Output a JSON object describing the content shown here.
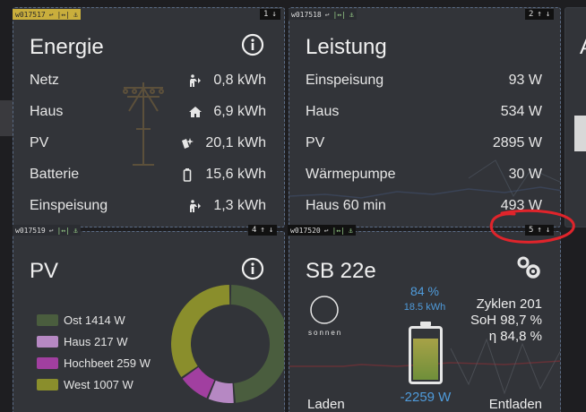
{
  "colors": {
    "card_bg": "#34363c",
    "accent_blue": "#4f9bdb",
    "border_dashed": "#5b6c86",
    "annotation_red": "#e0242b",
    "pv_ost": "#4a5d3e",
    "pv_haus": "#b688c3",
    "pv_hochbeet": "#a13fa0",
    "pv_west": "#8a8e2c"
  },
  "widgets": {
    "energie": {
      "id": "w017517",
      "order": "1"
    },
    "leistung": {
      "id": "w017518",
      "order": "2"
    },
    "pv": {
      "id": "w017519",
      "order": "4"
    },
    "sb": {
      "id": "w017520",
      "order": "5"
    }
  },
  "energie": {
    "title": "Energie",
    "rows": [
      {
        "label": "Netz",
        "icon": "pylon-person-icon",
        "value": "0,8 kWh"
      },
      {
        "label": "Haus",
        "icon": "house-icon",
        "value": "6,9 kWh"
      },
      {
        "label": "PV",
        "icon": "solar-panel-icon",
        "value": "20,1 kWh"
      },
      {
        "label": "Batterie",
        "icon": "battery-icon",
        "value": "15,6 kWh"
      },
      {
        "label": "Einspeisung",
        "icon": "pylon-person-icon",
        "value": "1,3 kWh"
      }
    ]
  },
  "leistung": {
    "title": "Leistung",
    "rows": [
      {
        "label": "Einspeisung",
        "value": "93 W"
      },
      {
        "label": "Haus",
        "value": "534 W"
      },
      {
        "label": "PV",
        "value": "2895 W"
      },
      {
        "label": "Wärmepumpe",
        "value": "30 W"
      },
      {
        "label": "Haus 60 min",
        "value": "493 W"
      }
    ]
  },
  "pv": {
    "title": "PV",
    "legend": [
      {
        "label": "Ost 1414 W",
        "value": 1414,
        "color": "#4a5d3e"
      },
      {
        "label": "Haus 217 W",
        "value": 217,
        "color": "#b688c3"
      },
      {
        "label": "Hochbeet 259 W",
        "value": 259,
        "color": "#a13fa0"
      },
      {
        "label": "West 1007 W",
        "value": 1007,
        "color": "#8a8e2c"
      }
    ]
  },
  "sb": {
    "title": "SB 22e",
    "brand": "sonnen",
    "soc": "84 %",
    "soc_fraction": 0.84,
    "energy": "18.5 kWh",
    "power": "-2259 W",
    "cycles": "Zyklen 201",
    "soh": "SoH 98,7 %",
    "eta": "η 84,8 %",
    "charge_label": "Laden",
    "discharge_label": "Entladen"
  },
  "partial_card": {
    "title_initial": "A"
  }
}
